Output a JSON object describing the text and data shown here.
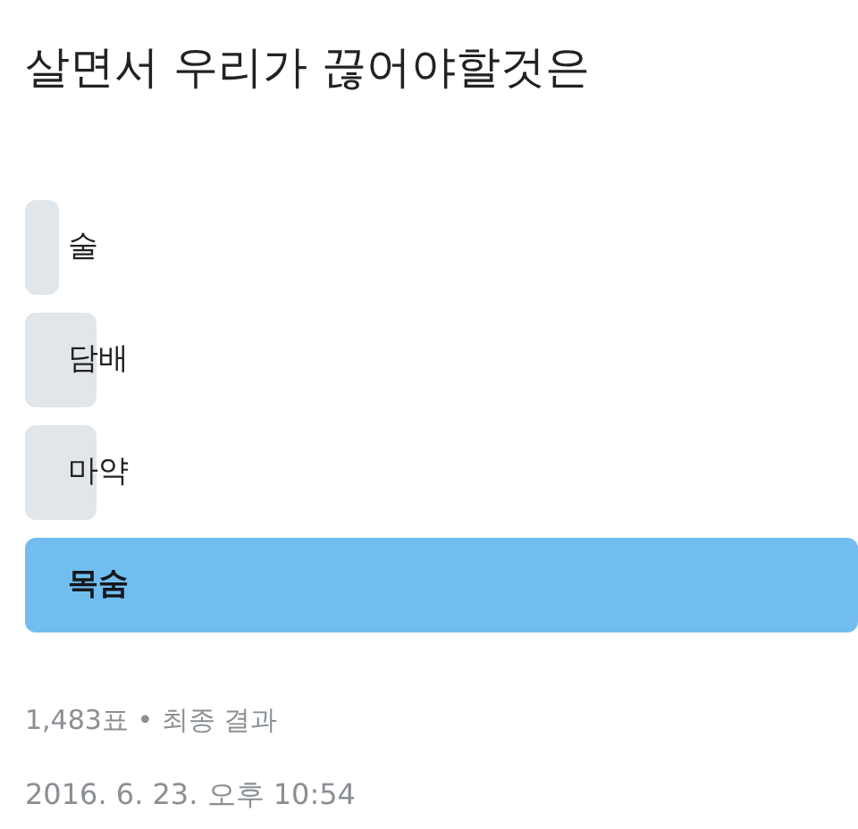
{
  "title": "살면서 우리가 끊어야할것은",
  "options": [
    {
      "label": "술",
      "level": 0.04,
      "leading": false
    },
    {
      "label": "담배",
      "level": 0.085,
      "leading": false
    },
    {
      "label": "마약",
      "level": 0.085,
      "leading": false
    },
    {
      "label": "목숨",
      "level": 1,
      "leading": true
    }
  ],
  "summary": "1,483표 • 최종 결과",
  "timestamp": "2016. 6. 23. 오후 10:54"
}
